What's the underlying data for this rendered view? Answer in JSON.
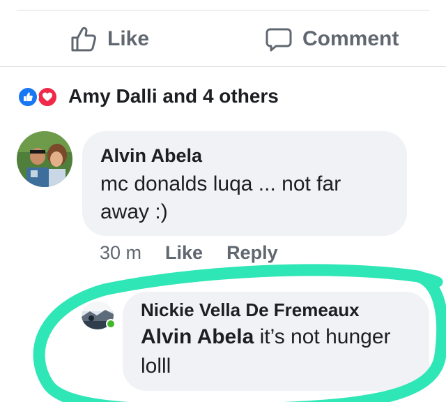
{
  "actions": {
    "like_label": "Like",
    "comment_label": "Comment"
  },
  "reactions": {
    "summary": "Amy Dalli and 4 others"
  },
  "comment": {
    "author": "Alvin Abela",
    "text": "mc donalds luqa ... not far away :)",
    "time": "30 m",
    "like_label": "Like",
    "reply_label": "Reply"
  },
  "reply": {
    "author": "Nickie Vella De Fremeaux",
    "mention": "Alvin Abela",
    "text": " it’s not hunger lolll"
  },
  "colors": {
    "bubble": "#f0f2f5",
    "like_blue": "#1877f2",
    "love_red": "#f0284a",
    "online_green": "#42b72a",
    "highlight": "#2ee6b6"
  }
}
